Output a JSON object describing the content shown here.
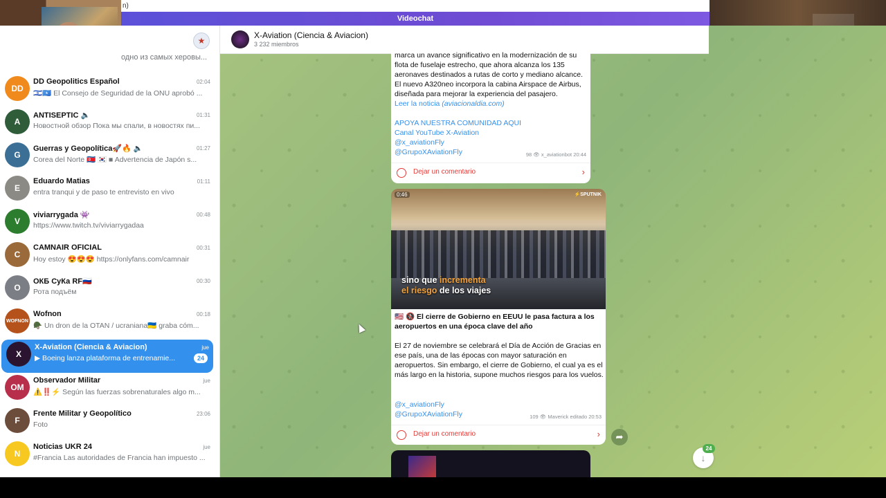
{
  "topbar": {
    "text": "n)"
  },
  "videochat": {
    "label": "Videochat"
  },
  "sidebar": {
    "peek_text": "одно из самых херовы...",
    "chats": [
      {
        "name": "DD Geopolitics Español",
        "time": "02:04",
        "preview": "🇮🇱🇸🇴 El Consejo de Seguridad de la ONU aprobó ...",
        "avatar": "DD",
        "color": "#f08a1c"
      },
      {
        "name": "ANTISEPTIC 🔈",
        "time": "01:31",
        "preview": "Новостной обзор Пока мы спали, в новостях пи...",
        "avatar": "A",
        "color": "#2f5d3a"
      },
      {
        "name": "Guerras y Geopolítica🚀🔥 🔈",
        "time": "01:27",
        "preview": "Corea del Norte 🇰🇵 🇰🇷 ■ Advertencia de Japón s...",
        "avatar": "G",
        "color": "#3b6f95"
      },
      {
        "name": "Eduardo Matias",
        "time": "01:11",
        "preview": "entra tranqui y de paso te entrevisto en vivo",
        "avatar": "E",
        "color": "#8c8a85"
      },
      {
        "name": "viviarrygada 👾",
        "time": "00:48",
        "preview": "https://www.twitch.tv/viviarrygadaa",
        "avatar": "V",
        "color": "#2d7d2f"
      },
      {
        "name": "CAMNAIR OFICIAL",
        "time": "00:31",
        "preview": "Hoy estoy 😍😍😍 https://onlyfans.com/camnair",
        "avatar": "C",
        "color": "#9b6a3a"
      },
      {
        "name": "ОКБ СуКа RF🇷🇺",
        "time": "00:30",
        "preview": "Рота подъём",
        "avatar": "О",
        "color": "#7b7e84"
      },
      {
        "name": "Wofnon",
        "time": "00:18",
        "preview": "🪖 Un dron de la OTAN / ucraniana🇺🇦 graba cóm...",
        "avatar": "WOFNON",
        "color": "#b5521b"
      },
      {
        "name": "X-Aviation (Ciencia & Aviacion)",
        "time": "jue",
        "preview": "▶ Boeing lanza plataforma de entrenamie...",
        "avatar": "X",
        "color": "#2a1430",
        "badge": "24",
        "active": true
      },
      {
        "name": "Observador Militar",
        "time": "jue",
        "preview": "⚠️‼️⚡ Según las fuerzas sobrenaturales algo m...",
        "avatar": "OM",
        "color": "#b72f4a"
      },
      {
        "name": "Frente Militar y Geopolítico",
        "time": "23:06",
        "preview": "Foto",
        "avatar": "F",
        "color": "#6c4c3a"
      },
      {
        "name": "Noticias UKR 24",
        "time": "jue",
        "preview": "#Francia Las autoridades de Francia han impuesto ...",
        "avatar": "N",
        "color": "#f7c81f"
      }
    ]
  },
  "header": {
    "title": "X-Aviation (Ciencia & Aviacion)",
    "subtitle": "3 232 miembros"
  },
  "post1": {
    "lines": [
      "marca un avance significativo en la modernización de su",
      "flota de fuselaje estrecho, que ahora alcanza los 135",
      "aeronaves destinados a rutas de corto y mediano alcance.",
      "El nuevo A320neo incorpora la cabina Airspace de Airbus,",
      "diseñada para mejorar la experiencia del pasajero."
    ],
    "read_more": "Leer la noticia",
    "read_more_source": "(aviacionaldia.com)",
    "links": [
      "APOYA NUESTRA COMUNIDAD AQUI",
      "Canal YouTube X-Aviation",
      "@x_aviationFly",
      "@GrupoXAviationFly"
    ],
    "views": "98",
    "author": "x_aviationbot",
    "time": "20:44",
    "comment": "Dejar un comentario"
  },
  "post2": {
    "video": {
      "duration": "0:46",
      "brand": "⚡SPUTNIK",
      "caption1": "sino que ",
      "caption_hl1": "incrementa",
      "caption_hl2": "el riesgo",
      "caption2": " de los viajes"
    },
    "headline": "🇺🇸 🚷 El cierre de Gobierno en EEUU le pasa factura a los aeropuertos en una época clave del año",
    "body": "El 27 de noviembre se celebrará el Día de Acción de Gracias en ese país, una de las épocas con mayor saturación en aeropuertos. Sin embargo, el cierre de Gobierno, el cual ya es el más largo en la historia, supone muchos riesgos para los vuelos.",
    "links": [
      "@x_aviationFly",
      "@GrupoXAviationFly"
    ],
    "views": "109",
    "author": "Maverick",
    "edited": "editado 20:53",
    "comment": "Dejar un comentario"
  },
  "scroll_badge": "24",
  "colors": {
    "accent": "#3390ec",
    "comment": "#e53935",
    "videochat": "#6f4bd3",
    "background": "#9fbd7c"
  }
}
